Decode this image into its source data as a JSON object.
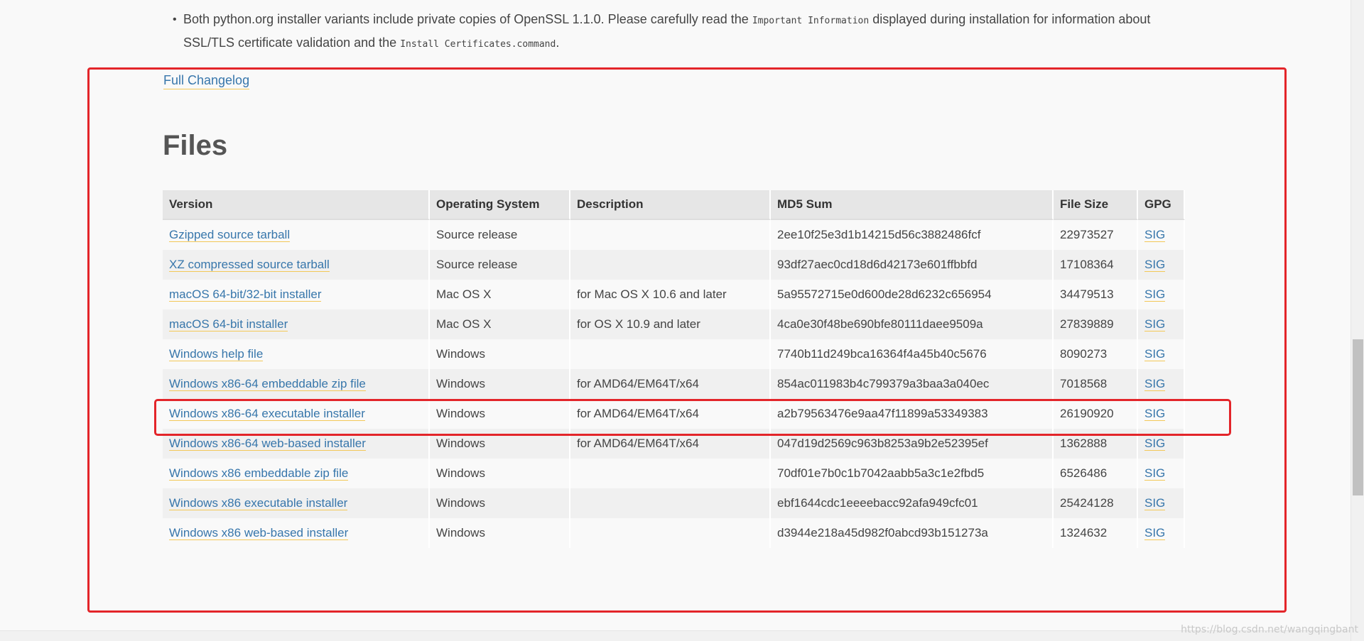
{
  "note": {
    "part1": "Both python.org installer variants include private copies of OpenSSL 1.1.0. Please carefully read the ",
    "code1": "Important Information",
    "part2": " displayed during installation for information about SSL/TLS certificate validation and the ",
    "code2": "Install Certificates.command",
    "part3": "."
  },
  "changelog_link": "Full Changelog",
  "files_title": "Files",
  "table": {
    "headers": [
      "Version",
      "Operating System",
      "Description",
      "MD5 Sum",
      "File Size",
      "GPG"
    ],
    "rows": [
      [
        "Gzipped source tarball",
        "Source release",
        "",
        "2ee10f25e3d1b14215d56c3882486fcf",
        "22973527",
        "SIG"
      ],
      [
        "XZ compressed source tarball",
        "Source release",
        "",
        "93df27aec0cd18d6d42173e601ffbbfd",
        "17108364",
        "SIG"
      ],
      [
        "macOS 64-bit/32-bit installer",
        "Mac OS X",
        "for Mac OS X 10.6 and later",
        "5a95572715e0d600de28d6232c656954",
        "34479513",
        "SIG"
      ],
      [
        "macOS 64-bit installer",
        "Mac OS X",
        "for OS X 10.9 and later",
        "4ca0e30f48be690bfe80111daee9509a",
        "27839889",
        "SIG"
      ],
      [
        "Windows help file",
        "Windows",
        "",
        "7740b11d249bca16364f4a45b40c5676",
        "8090273",
        "SIG"
      ],
      [
        "Windows x86-64 embeddable zip file",
        "Windows",
        "for AMD64/EM64T/x64",
        "854ac011983b4c799379a3baa3a040ec",
        "7018568",
        "SIG"
      ],
      [
        "Windows x86-64 executable installer",
        "Windows",
        "for AMD64/EM64T/x64",
        "a2b79563476e9aa47f11899a53349383",
        "26190920",
        "SIG"
      ],
      [
        "Windows x86-64 web-based installer",
        "Windows",
        "for AMD64/EM64T/x64",
        "047d19d2569c963b8253a9b2e52395ef",
        "1362888",
        "SIG"
      ],
      [
        "Windows x86 embeddable zip file",
        "Windows",
        "",
        "70df01e7b0c1b7042aabb5a3c1e2fbd5",
        "6526486",
        "SIG"
      ],
      [
        "Windows x86 executable installer",
        "Windows",
        "",
        "ebf1644cdc1eeeebacc92afa949cfc01",
        "25424128",
        "SIG"
      ],
      [
        "Windows x86 web-based installer",
        "Windows",
        "",
        "d3944e218a45d982f0abcd93b151273a",
        "1324632",
        "SIG"
      ]
    ]
  },
  "watermark": "https://blog.csdn.net/wangqingbant",
  "colors": {
    "link": "#3776ab",
    "highlight": "#e3252a",
    "link_underline": "#f3c858"
  }
}
